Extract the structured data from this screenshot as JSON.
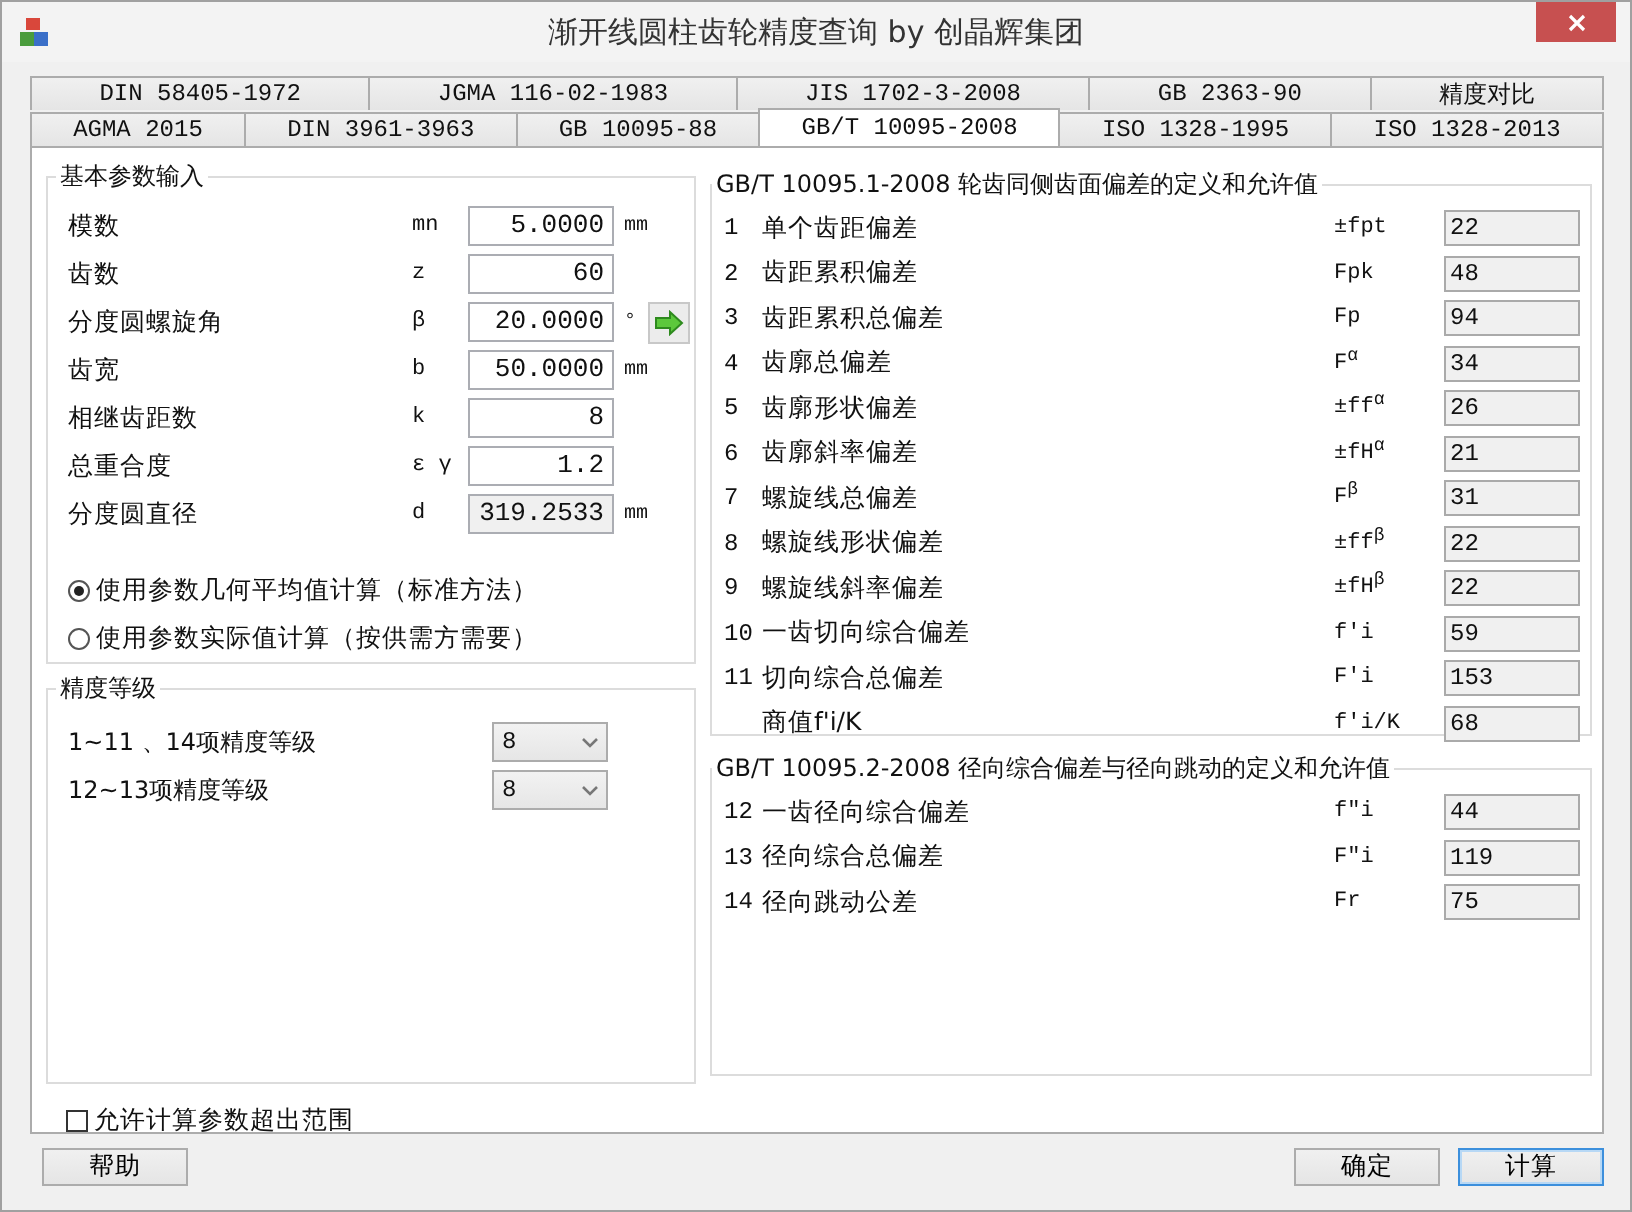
{
  "window": {
    "title": "渐开线圆柱齿轮精度查询 by 创晶辉集团"
  },
  "tab_rows": [
    {
      "tabs": [
        {
          "label": "DIN 58405-1972",
          "selected": false
        },
        {
          "label": "JGMA 116-02-1983",
          "selected": false
        },
        {
          "label": "JIS 1702-3-2008",
          "selected": false
        },
        {
          "label": "GB 2363-90",
          "selected": false
        },
        {
          "label": "精度对比",
          "selected": false
        }
      ]
    },
    {
      "tabs": [
        {
          "label": "AGMA 2015",
          "selected": false
        },
        {
          "label": "DIN 3961-3963",
          "selected": false
        },
        {
          "label": "GB 10095-88",
          "selected": false
        },
        {
          "label": "GB/T 10095-2008",
          "selected": true
        },
        {
          "label": "ISO 1328-1995",
          "selected": false
        },
        {
          "label": "ISO 1328-2013",
          "selected": false
        }
      ]
    }
  ],
  "basic_params": {
    "title": "基本参数输入",
    "rows": [
      {
        "kind": "field",
        "label": "模数",
        "symbol": "mn",
        "value": "5.0000",
        "unit": "mm",
        "readonly": false
      },
      {
        "kind": "field",
        "label": "齿数",
        "symbol": "z",
        "value": "60",
        "readonly": false
      },
      {
        "kind": "field-with-button",
        "label": "分度圆螺旋角",
        "symbol": "β",
        "value": "20.0000",
        "unit": "°",
        "readonly": false
      },
      {
        "kind": "field",
        "label": "齿宽",
        "symbol": "b",
        "value": "50.0000",
        "unit": "mm",
        "readonly": false
      },
      {
        "kind": "field",
        "label": "相继齿距数",
        "symbol": "k",
        "value": "8",
        "readonly": false
      },
      {
        "kind": "field",
        "label": "总重合度",
        "symbol": "ε γ",
        "value": "1.2",
        "readonly": false
      },
      {
        "kind": "field",
        "label": "分度圆直径",
        "symbol": "d",
        "value": "319.2533",
        "unit": "mm",
        "readonly": true
      }
    ],
    "methods": [
      {
        "label": "使用参数几何平均值计算（标准方法）",
        "selected": true
      },
      {
        "label": "使用参数实际值计算（按供需方需要）",
        "selected": false
      }
    ]
  },
  "grade": {
    "title": "精度等级",
    "rows": [
      {
        "label": "1~11 、14项精度等级",
        "value": "8"
      },
      {
        "label": "12~13项精度等级",
        "value": "8"
      }
    ]
  },
  "allow_out_of_range": {
    "label": "允许计算参数超出范围",
    "checked": false
  },
  "deviation_groups": [
    {
      "title": "GB/T 10095.1-2008 轮齿同侧齿面偏差的定义和允许值",
      "rows": [
        {
          "number": "1",
          "name": "单个齿距偏差",
          "symbol": "±fpt",
          "value": "22"
        },
        {
          "number": "2",
          "name": "齿距累积偏差",
          "symbol": "Fpk",
          "value": "48"
        },
        {
          "number": "3",
          "name": "齿距累积总偏差",
          "symbol": "Fp",
          "value": "94"
        },
        {
          "number": "4",
          "name": "齿廓总偏差",
          "symbol": "F$^{α}$",
          "value": "34"
        },
        {
          "number": "5",
          "name": "齿廓形状偏差",
          "symbol": "±ff$^{α}$",
          "value": "26"
        },
        {
          "number": "6",
          "name": "齿廓斜率偏差",
          "symbol": "±fH$^{α}$",
          "value": "21"
        },
        {
          "number": "7",
          "name": "螺旋线总偏差",
          "symbol": "F$^{β}$",
          "value": "31"
        },
        {
          "number": "8",
          "name": "螺旋线形状偏差",
          "symbol": "±ff$^{β}$",
          "value": "22"
        },
        {
          "number": "9",
          "name": "螺旋线斜率偏差",
          "symbol": "±fH$^{β}$",
          "value": "22"
        },
        {
          "number": "10",
          "name": "一齿切向综合偏差",
          "symbol": "f'i",
          "value": "59"
        },
        {
          "number": "11",
          "name": "切向综合总偏差",
          "symbol": "F'i",
          "value": "153"
        },
        {
          "name": "商值f'i/K",
          "symbol": "f'i/K",
          "value": "68"
        }
      ]
    },
    {
      "title": "GB/T 10095.2-2008 径向综合偏差与径向跳动的定义和允许值",
      "rows": [
        {
          "number": "12",
          "name": "一齿径向综合偏差",
          "symbol": "f\"i",
          "value": "44"
        },
        {
          "number": "13",
          "name": "径向综合总偏差",
          "symbol": "F\"i",
          "value": "119"
        },
        {
          "number": "14",
          "name": "径向跳动公差",
          "symbol": "Fr",
          "value": "75"
        }
      ]
    }
  ],
  "buttons": {
    "left": [
      {
        "label": "帮助",
        "default": false
      }
    ],
    "right": [
      {
        "label": "确定",
        "default": false
      },
      {
        "label": "计算",
        "default": true
      }
    ]
  }
}
